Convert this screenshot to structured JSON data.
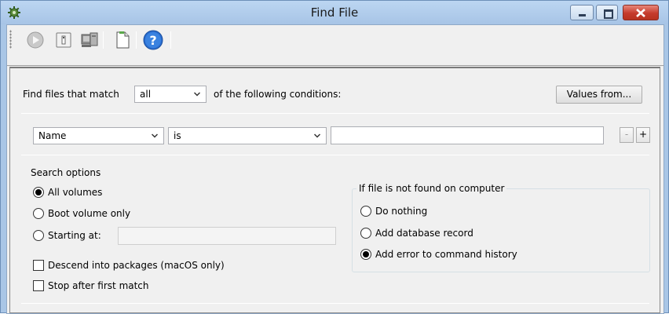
{
  "window": {
    "title": "Find File",
    "app_icon": "gear-icon",
    "controls": [
      "minimize-icon",
      "maximize-icon",
      "close-icon"
    ]
  },
  "toolbar": {
    "items": [
      "play-icon",
      "info-icon",
      "computer-icon",
      "document-icon",
      "help-icon"
    ]
  },
  "match": {
    "prefix": "Find files that match",
    "mode": "all",
    "suffix": "of the following conditions:",
    "values_button": "Values from..."
  },
  "condition": {
    "field": "Name",
    "operator": "is",
    "value": "",
    "remove_label": "-",
    "add_label": "+"
  },
  "search_options": {
    "title": "Search options",
    "all_volumes": "All volumes",
    "boot_volume": "Boot volume only",
    "starting_at": "Starting at:",
    "starting_at_value": "",
    "descend": "Descend into packages (macOS only)",
    "stop_first": "Stop after first match",
    "selected": "All volumes"
  },
  "not_found": {
    "title": "If file is not found on computer",
    "do_nothing": "Do nothing",
    "add_record": "Add database record",
    "add_error": "Add error to command history",
    "selected": "Add error to command history"
  },
  "colors": {
    "title_bar": "#a7c4e6",
    "close_button": "#c53b2c",
    "panel_bg": "#f0f0f0"
  }
}
